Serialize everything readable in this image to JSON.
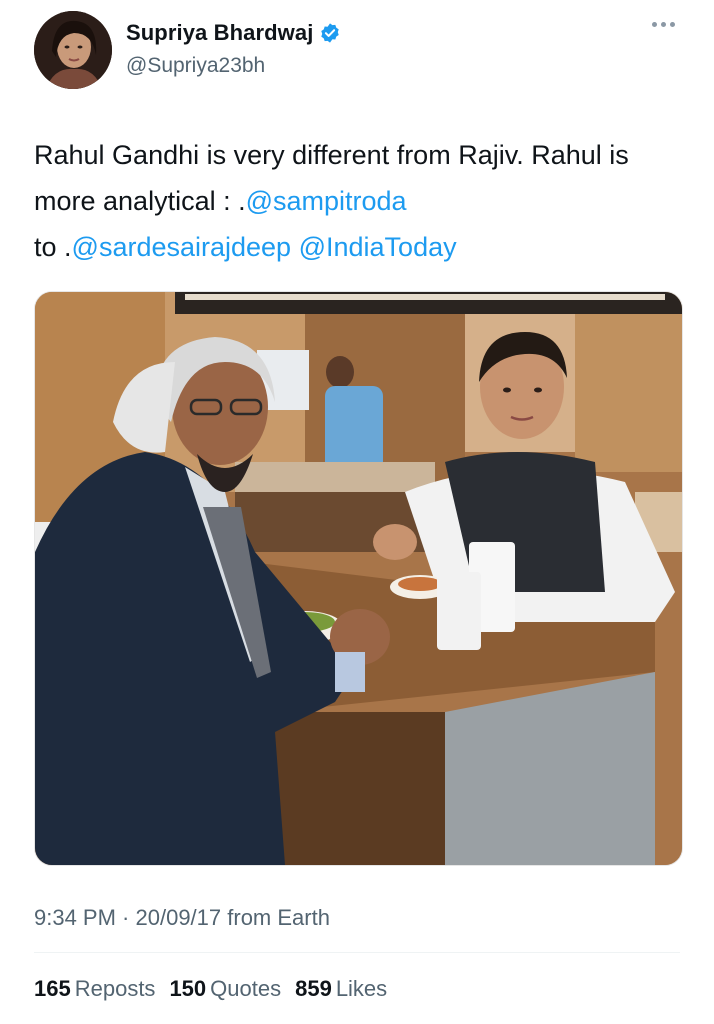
{
  "author": {
    "display_name": "Supriya Bhardwaj",
    "handle": "@Supriya23bh",
    "verified": true
  },
  "tweet": {
    "text_1": "Rahul Gandhi is very different from Rajiv. Rahul is more analytical : .",
    "mention_1": "@sampitroda",
    "text_2": " to .",
    "mention_2": "@sardesairajdeep",
    "text_3": " ",
    "mention_3": "@IndiaToday"
  },
  "meta": {
    "time": "9:34 PM",
    "separator": " · ",
    "date": "20/09/17",
    "source": " from Earth"
  },
  "stats": {
    "reposts_count": "165",
    "reposts_label": "Reposts",
    "quotes_count": "150",
    "quotes_label": "Quotes",
    "likes_count": "859",
    "likes_label": "Likes"
  },
  "colors": {
    "link": "#1d9bf0",
    "secondary_text": "#536471",
    "verified_badge": "#1d9bf0"
  }
}
